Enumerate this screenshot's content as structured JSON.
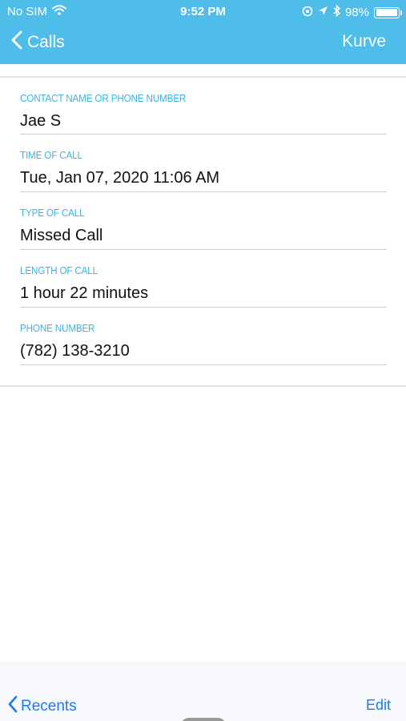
{
  "status_bar": {
    "carrier": "No SIM",
    "time": "9:52 PM",
    "battery": "98%",
    "battery_level": 0.98
  },
  "nav": {
    "back_label": "Calls",
    "title": "Kurve"
  },
  "fields": [
    {
      "label": "CONTACT NAME OR PHONE NUMBER",
      "value": "Jae S"
    },
    {
      "label": "TIME OF CALL",
      "value": "Tue, Jan 07, 2020 11:06 AM"
    },
    {
      "label": "TYPE OF CALL",
      "value": "Missed Call"
    },
    {
      "label": "LENGTH OF CALL",
      "value": "1 hour 22 minutes"
    },
    {
      "label": "PHONE NUMBER",
      "value": "(782) 138-3210"
    }
  ],
  "tab_bar": {
    "back_label": "Recents",
    "edit_label": "Edit"
  },
  "colors": {
    "header": "#4ebde9",
    "label": "#3cb4e3",
    "link": "#1a7af5"
  },
  "icons": [
    "wifi-icon",
    "location-icon",
    "bluetooth-icon",
    "orientation-lock-icon",
    "battery-icon",
    "chevron-left-icon"
  ]
}
